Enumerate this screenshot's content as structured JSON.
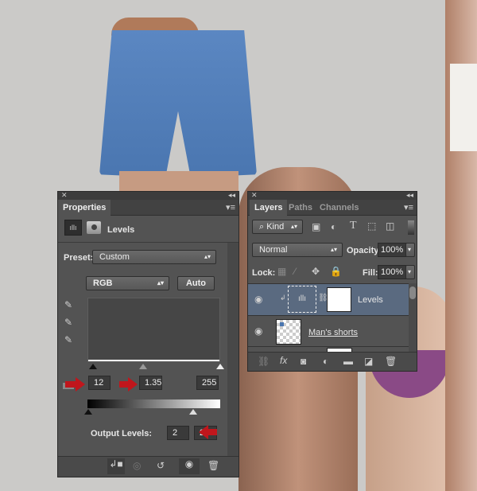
{
  "properties": {
    "tab": "Properties",
    "adjustment_title": "Levels",
    "preset_label": "Preset:",
    "preset_value": "Custom",
    "channel_value": "RGB",
    "auto_button": "Auto",
    "input_black": "12",
    "input_gamma": "1.35",
    "input_white": "255",
    "output_label": "Output Levels:",
    "output_black": "2",
    "output_white": "203"
  },
  "layers": {
    "tabs": [
      "Layers",
      "Paths",
      "Channels"
    ],
    "filter_kind": "Kind",
    "blend_mode": "Normal",
    "opacity_label": "Opacity:",
    "opacity_value": "100%",
    "lock_label": "Lock:",
    "fill_label": "Fill:",
    "fill_value": "100%",
    "items": [
      {
        "name": "Levels",
        "selected": true
      },
      {
        "name": "Man's shorts",
        "selected": false
      }
    ]
  },
  "colors": {
    "annotation_arrow": "#c0161c",
    "selected_layer": "#5a6a80"
  }
}
